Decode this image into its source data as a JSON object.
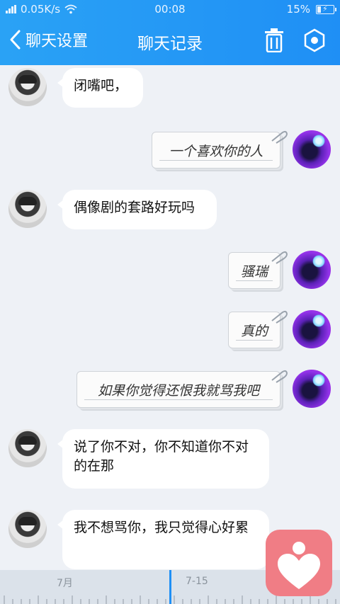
{
  "status_bar": {
    "network_speed": "0.05K/s",
    "time": "00:08",
    "battery": "15%"
  },
  "nav": {
    "back_label": "聊天设置",
    "title": "聊天记录"
  },
  "messages": [
    {
      "from": "friend",
      "text": "闭嘴吧，"
    },
    {
      "from": "me",
      "text": "一个喜欢你的人"
    },
    {
      "from": "friend",
      "text": "偶像剧的套路好玩吗"
    },
    {
      "from": "me",
      "text": "骚瑞"
    },
    {
      "from": "me",
      "text": "真的"
    },
    {
      "from": "me",
      "text": "如果你觉得还恨我就骂我吧"
    },
    {
      "from": "friend",
      "text": "说了你不对，你不知道你不对的在那"
    },
    {
      "from": "friend",
      "text": "我不想骂你，我只觉得心好累"
    }
  ],
  "timeline": {
    "labels": [
      "7月",
      "7-15"
    ]
  },
  "colors": {
    "header": "#1f8ff5",
    "background": "#eef1f6",
    "fab": "#f07d85"
  },
  "icons": {
    "back": "chevron-left-icon",
    "trash": "trash-icon",
    "settings": "hexagon-settings-icon",
    "heart": "heart-person-icon",
    "clip": "paperclip-icon"
  }
}
